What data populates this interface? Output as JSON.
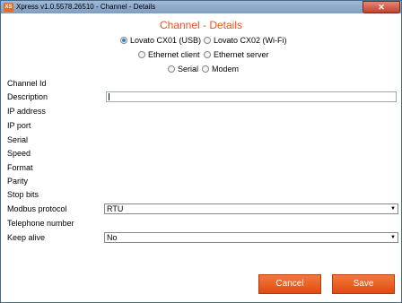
{
  "window": {
    "title": "Xpress v1.0.5578.26510 - Channel - Details",
    "app_icon": "XS",
    "close_symbol": "✕"
  },
  "form": {
    "heading": "Channel - Details",
    "radios": [
      {
        "label": "Lovato CX01 (USB)",
        "selected": true
      },
      {
        "label": "Lovato CX02 (Wi-Fi)",
        "selected": false
      },
      {
        "label": "Ethernet client",
        "selected": false
      },
      {
        "label": "Ethernet server",
        "selected": false
      },
      {
        "label": "Serial",
        "selected": false
      },
      {
        "label": "Modem",
        "selected": false
      }
    ],
    "labels": {
      "channel_id": "Channel Id",
      "description": "Description",
      "ip_address": "IP address",
      "ip_port": "IP port",
      "serial": "Serial",
      "speed": "Speed",
      "format": "Format",
      "parity": "Parity",
      "stop_bits": "Stop bits",
      "modbus_protocol": "Modbus protocol",
      "telephone_number": "Telephone number",
      "keep_alive": "Keep alive"
    },
    "description_value": "",
    "modbus_protocol_value": "RTU",
    "keep_alive_value": "No",
    "dropdown_arrow": "▼"
  },
  "buttons": {
    "cancel": "Cancel",
    "save": "Save"
  },
  "colors": {
    "accent": "#e8541e",
    "titlebar": "#8faecf"
  }
}
